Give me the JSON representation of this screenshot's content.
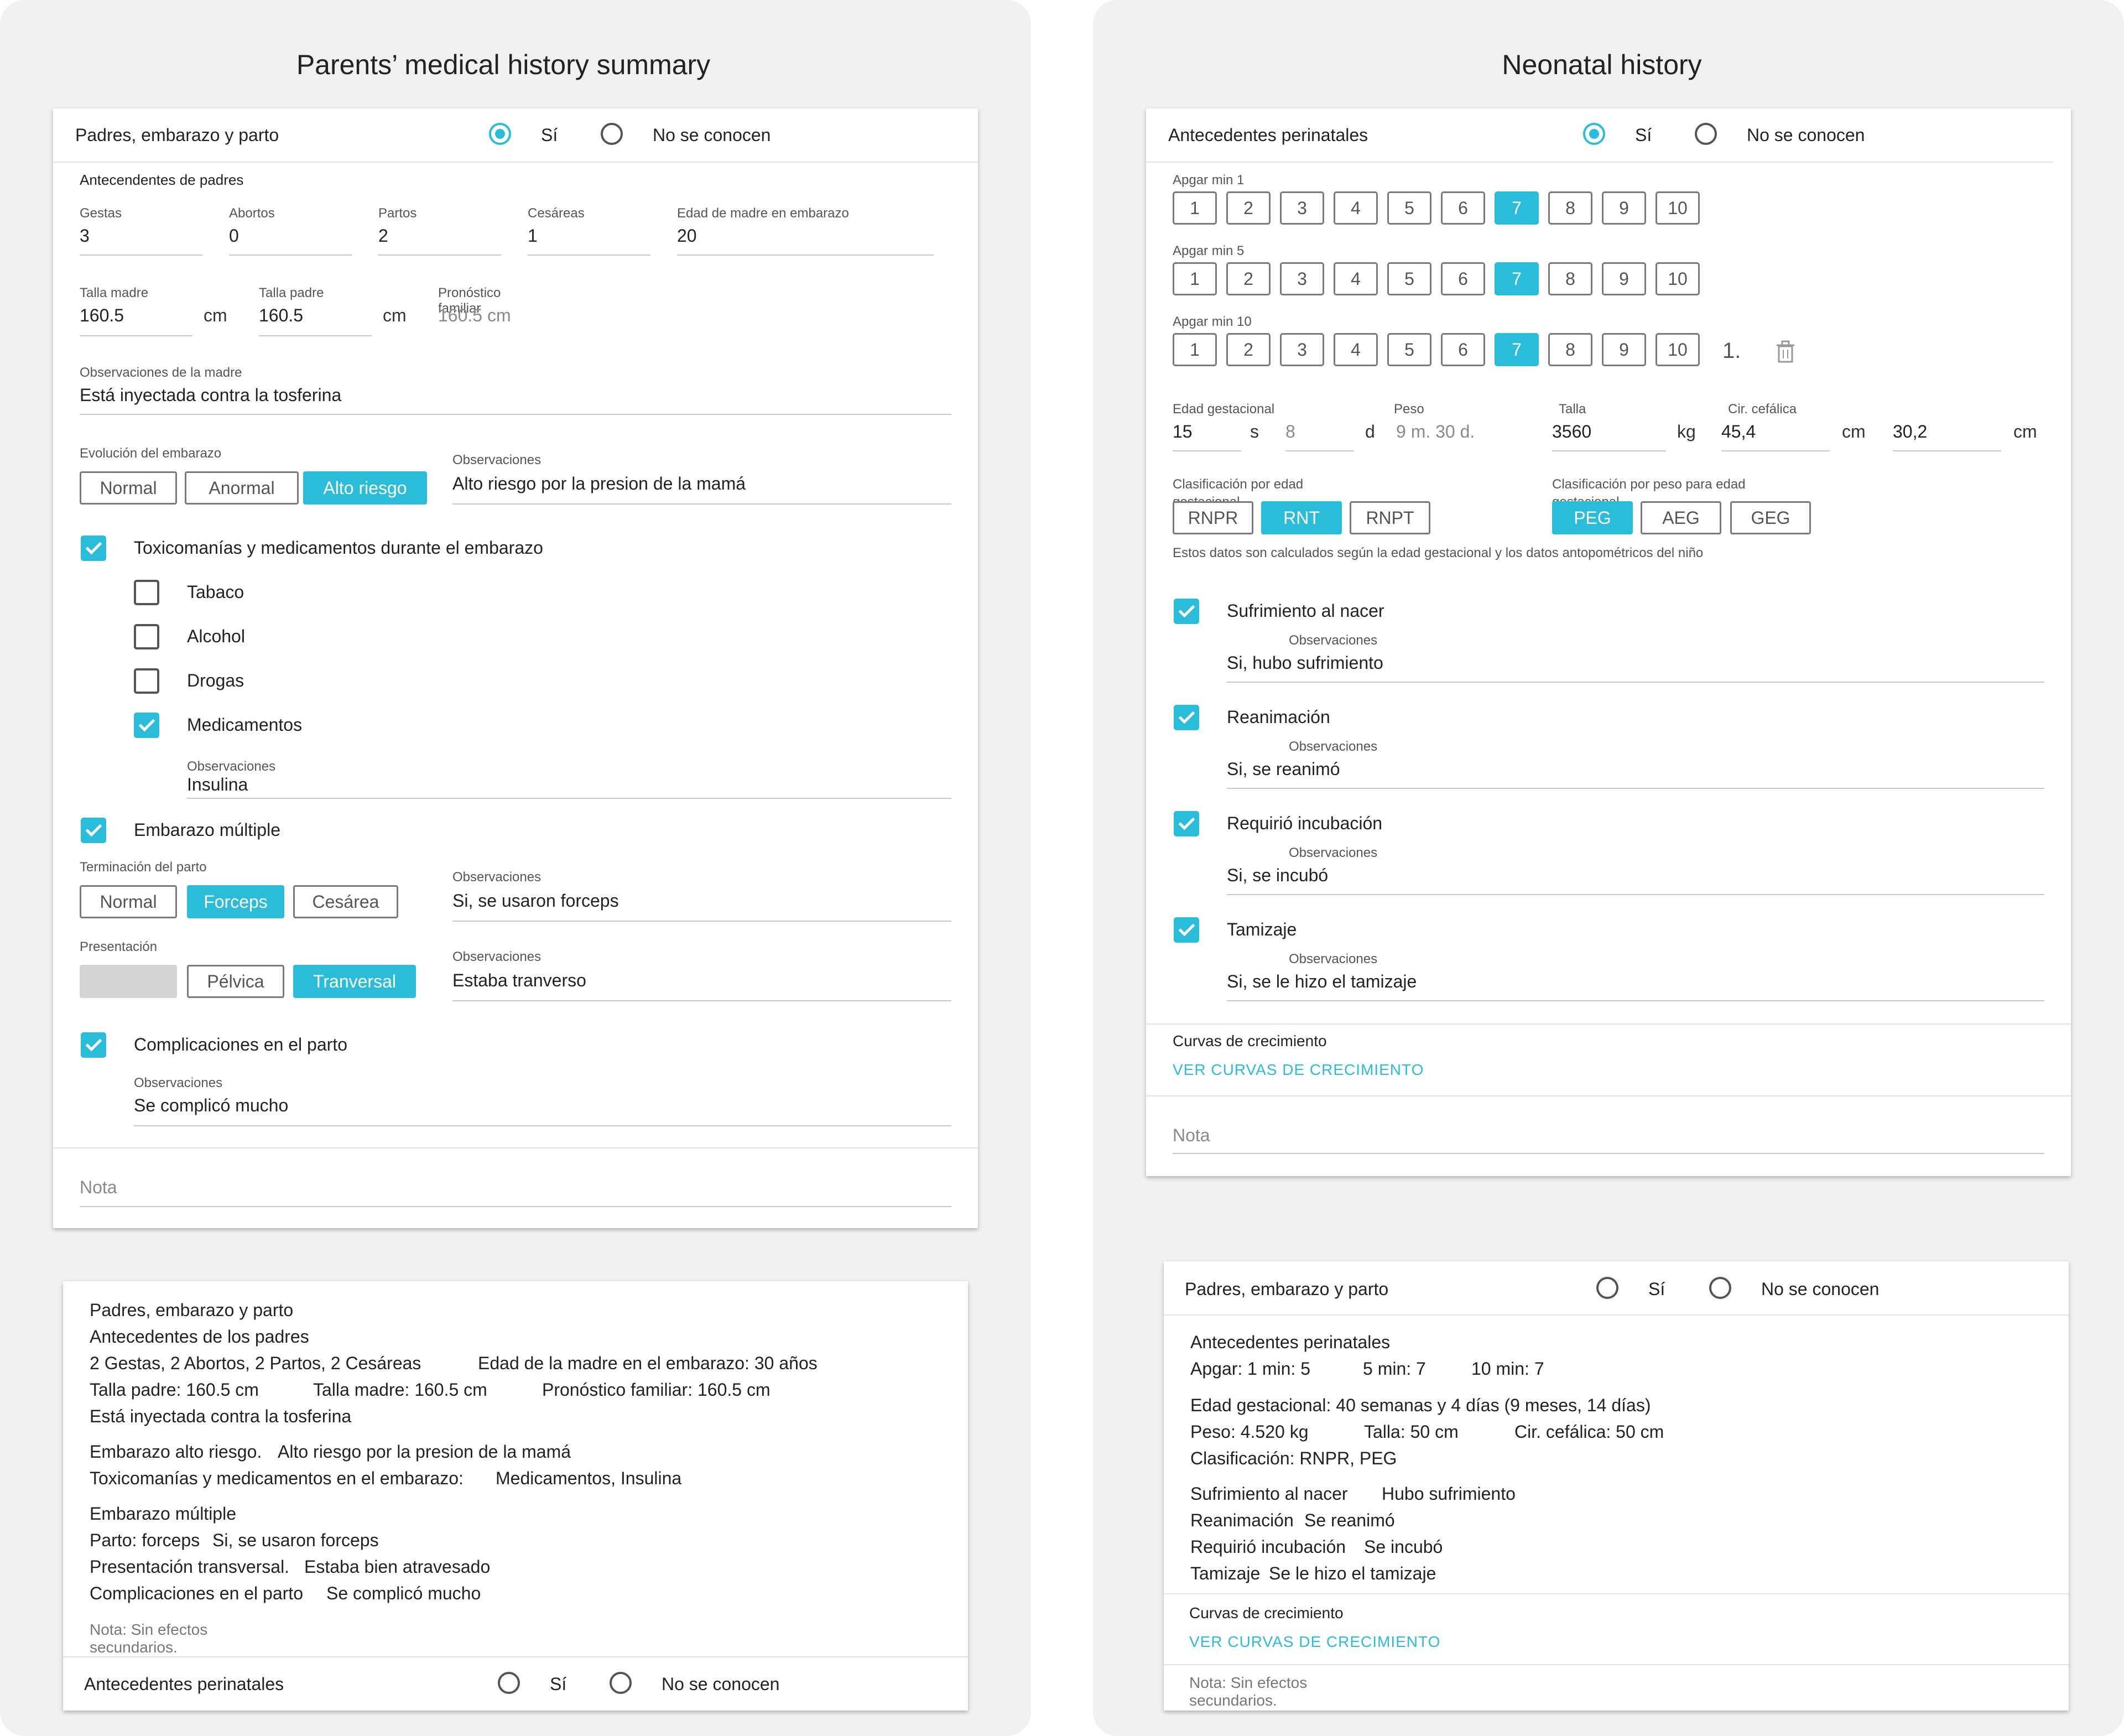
{
  "left": {
    "title": "Parents’ medical history summary",
    "form": {
      "header": {
        "label": "Padres, embarazo y parto",
        "yes": "Sí",
        "unknown": "No se conocen"
      },
      "section_label": "Antecendentes de padres",
      "gestas": {
        "label": "Gestas",
        "value": "3"
      },
      "abortos": {
        "label": "Abortos",
        "value": "0"
      },
      "partos": {
        "label": "Partos",
        "value": "2"
      },
      "cesareas": {
        "label": "Cesáreas",
        "value": "1"
      },
      "edad_madre": {
        "label": "Edad de madre en embarazo",
        "value": "20"
      },
      "talla_madre": {
        "label": "Talla madre",
        "value": "160.5",
        "unit": "cm"
      },
      "talla_padre": {
        "label": "Talla padre",
        "value": "160.5",
        "unit": "cm"
      },
      "pronostico": {
        "label": "Pronóstico familiar",
        "value": "160.5 cm"
      },
      "obs_madre": {
        "label": "Observaciones de la madre",
        "value": "Está inyectada contra la tosferina"
      },
      "evolucion": {
        "label": "Evolución del embarazo",
        "options": [
          "Normal",
          "Anormal",
          "Alto riesgo"
        ],
        "selected": "Alto riesgo"
      },
      "evolucion_obs": {
        "label": "Observaciones",
        "value": "Alto riesgo por la presion de la mamá"
      },
      "toxico": {
        "label": "Toxicomanías y medicamentos durante el embarazo",
        "checked": true
      },
      "tabaco": {
        "label": "Tabaco",
        "checked": false
      },
      "alcohol": {
        "label": "Alcohol",
        "checked": false
      },
      "drogas": {
        "label": "Drogas",
        "checked": false
      },
      "medicamentos": {
        "label": "Medicamentos",
        "checked": true
      },
      "med_obs": {
        "label": "Observaciones",
        "value": "Insulina"
      },
      "multiple": {
        "label": "Embarazo múltiple",
        "checked": true
      },
      "terminacion": {
        "label": "Terminación del parto",
        "options": [
          "Normal",
          "Forceps",
          "Cesárea"
        ],
        "selected": "Forceps"
      },
      "terminacion_obs": {
        "label": "Observaciones",
        "value": "Si, se usaron forceps"
      },
      "presentacion": {
        "label": "Presentación",
        "options": [
          "",
          "Pélvica",
          "Tranversal"
        ],
        "selected": "Tranversal"
      },
      "presentacion_obs": {
        "label": "Observaciones",
        "value": "Estaba tranverso"
      },
      "complicaciones": {
        "label": "Complicaciones en el parto",
        "checked": true
      },
      "comp_obs": {
        "label": "Observaciones",
        "value": "Se complicó mucho"
      },
      "nota_placeholder": "Nota"
    },
    "summary": {
      "l1": "Padres, embarazo y parto",
      "l2": "Antecedentes de los padres",
      "l3a": "2 Gestas, 2 Abortos, 2 Partos, 2 Cesáreas",
      "l3b": "Edad de la madre en el embarazo:  30 años",
      "l4a": "Talla padre: 160.5 cm",
      "l4b": "Talla madre: 160.5 cm",
      "l4c": "Pronóstico familiar:  160.5 cm",
      "l5": "Está inyectada contra la tosferina",
      "l6a": "Embarazo alto riesgo.",
      "l6b": "Alto riesgo por la presion de la mamá",
      "l7a": "Toxicomanías y medicamentos en el embarazo:",
      "l7b": "Medicamentos, Insulina",
      "l8": "Embarazo múltiple",
      "l9a": "Parto: forceps",
      "l9b": "Si, se usaron forceps",
      "l10a": "Presentación transversal.",
      "l10b": "Estaba bien atravesado",
      "l11a": "Complicaciones en el parto",
      "l11b": "Se complicó mucho",
      "nota1": "Nota: Sin efectos",
      "nota2": "secundarios.",
      "footer": {
        "label": "Antecedentes perinatales",
        "yes": "Sí",
        "unknown": "No se conocen"
      }
    }
  },
  "right": {
    "title": "Neonatal history",
    "form": {
      "header": {
        "label": "Antecedentes perinatales",
        "yes": "Sí",
        "unknown": "No se conocen"
      },
      "apgar": [
        {
          "label": "Apgar min 1",
          "selected": "7"
        },
        {
          "label": "Apgar min 5",
          "selected": "7"
        },
        {
          "label": "Apgar min 10",
          "selected": "7"
        }
      ],
      "apgar_values": [
        "1",
        "2",
        "3",
        "4",
        "5",
        "6",
        "7",
        "8",
        "9",
        "10"
      ],
      "apgar_extra": "1.",
      "edad_gest": {
        "label": "Edad gestacional",
        "weeks": "15",
        "weeks_unit": "s",
        "days": "8",
        "days_unit": "d"
      },
      "peso": {
        "label": "Peso",
        "value": "9 m. 30 d."
      },
      "talla": {
        "label": "Talla",
        "value": "3560",
        "unit": "kg"
      },
      "cir": {
        "label": "Cir. cefálica",
        "value": "45,4",
        "unit": "cm"
      },
      "cir2": {
        "value": "30,2",
        "unit": "cm"
      },
      "clas_edad": {
        "label": "Clasificación por edad gestacional",
        "options": [
          "RNPR",
          "RNT",
          "RNPT"
        ],
        "selected": "RNT"
      },
      "clas_peso": {
        "label": "Clasificación por peso para edad gestacional",
        "options": [
          "PEG",
          "AEG",
          "GEG"
        ],
        "selected": "PEG"
      },
      "calc_note": "Estos datos son calculados según la edad gestacional y los datos antopométricos del niño",
      "items": [
        {
          "label": "Sufrimiento al nacer",
          "obs_label": "Observaciones",
          "obs": "Si, hubo sufrimiento",
          "checked": true
        },
        {
          "label": "Reanimación",
          "obs_label": "Observaciones",
          "obs": "Si, se reanimó",
          "checked": true
        },
        {
          "label": "Requirió incubación",
          "obs_label": "Observaciones",
          "obs": "Si, se incubó",
          "checked": true
        },
        {
          "label": "Tamizaje",
          "obs_label": "Observaciones",
          "obs": "Si, se le hizo el tamizaje",
          "checked": true
        }
      ],
      "curvas_label": "Curvas de crecimiento",
      "curvas_link": "VER CURVAS DE CRECIMIENTO",
      "nota_placeholder": "Nota"
    },
    "summary": {
      "header": {
        "label": "Padres, embarazo y parto",
        "yes": "Sí",
        "unknown": "No se conocen"
      },
      "l1": "Antecedentes perinatales",
      "l2a": "Apgar: 1 min: 5",
      "l2b": "5 min: 7",
      "l2c": "10 min: 7",
      "l3": "Edad gestacional: 40 semanas y 4 días (9 meses, 14 días)",
      "l4a": "Peso: 4.520 kg",
      "l4b": "Talla: 50 cm",
      "l4c": "Cir. cefálica: 50 cm",
      "l5": "Clasificación: RNPR, PEG",
      "l6a": "Sufrimiento al nacer",
      "l6b": "Hubo sufrimiento",
      "l7a": "Reanimación",
      "l7b": "Se reanimó",
      "l8a": "Requirió incubación",
      "l8b": "Se incubó",
      "l9a": "Tamizaje",
      "l9b": "Se le hizo el tamizaje",
      "curvas_label": "Curvas de crecimiento",
      "curvas_link": "VER CURVAS DE CRECIMIENTO",
      "nota1": "Nota: Sin efectos",
      "nota2": "secundarios."
    }
  }
}
